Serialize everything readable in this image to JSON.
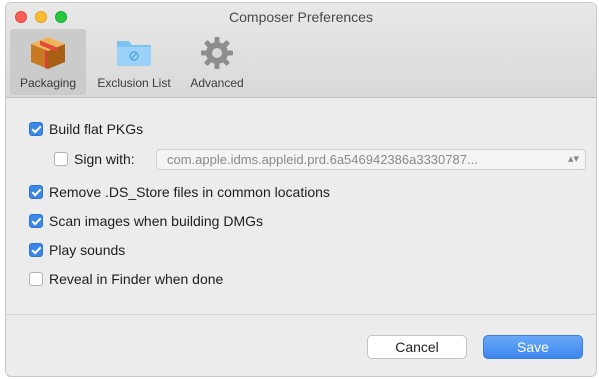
{
  "window": {
    "title": "Composer Preferences"
  },
  "toolbar": {
    "tabs": [
      {
        "label": "Packaging",
        "icon": "package-box-icon",
        "selected": true
      },
      {
        "label": "Exclusion List",
        "icon": "folder-icon",
        "selected": false
      },
      {
        "label": "Advanced",
        "icon": "gear-icon",
        "selected": false
      }
    ]
  },
  "options": {
    "build_flat_pkgs": {
      "label": "Build flat PKGs",
      "checked": true
    },
    "sign_with": {
      "label": "Sign with:",
      "checked": false,
      "value": "com.apple.idms.appleid.prd.6a546942386a3330787..."
    },
    "remove_ds_store": {
      "label": "Remove .DS_Store files in common locations",
      "checked": true
    },
    "scan_images": {
      "label": "Scan images when building DMGs",
      "checked": true
    },
    "play_sounds": {
      "label": "Play sounds",
      "checked": true
    },
    "reveal_in_finder": {
      "label": "Reveal in Finder when done",
      "checked": false
    }
  },
  "buttons": {
    "cancel": "Cancel",
    "save": "Save"
  },
  "colors": {
    "accent": "#3b87e8",
    "close": "#fc5f57",
    "minimize": "#fdbc2e",
    "maximize": "#27c840"
  }
}
